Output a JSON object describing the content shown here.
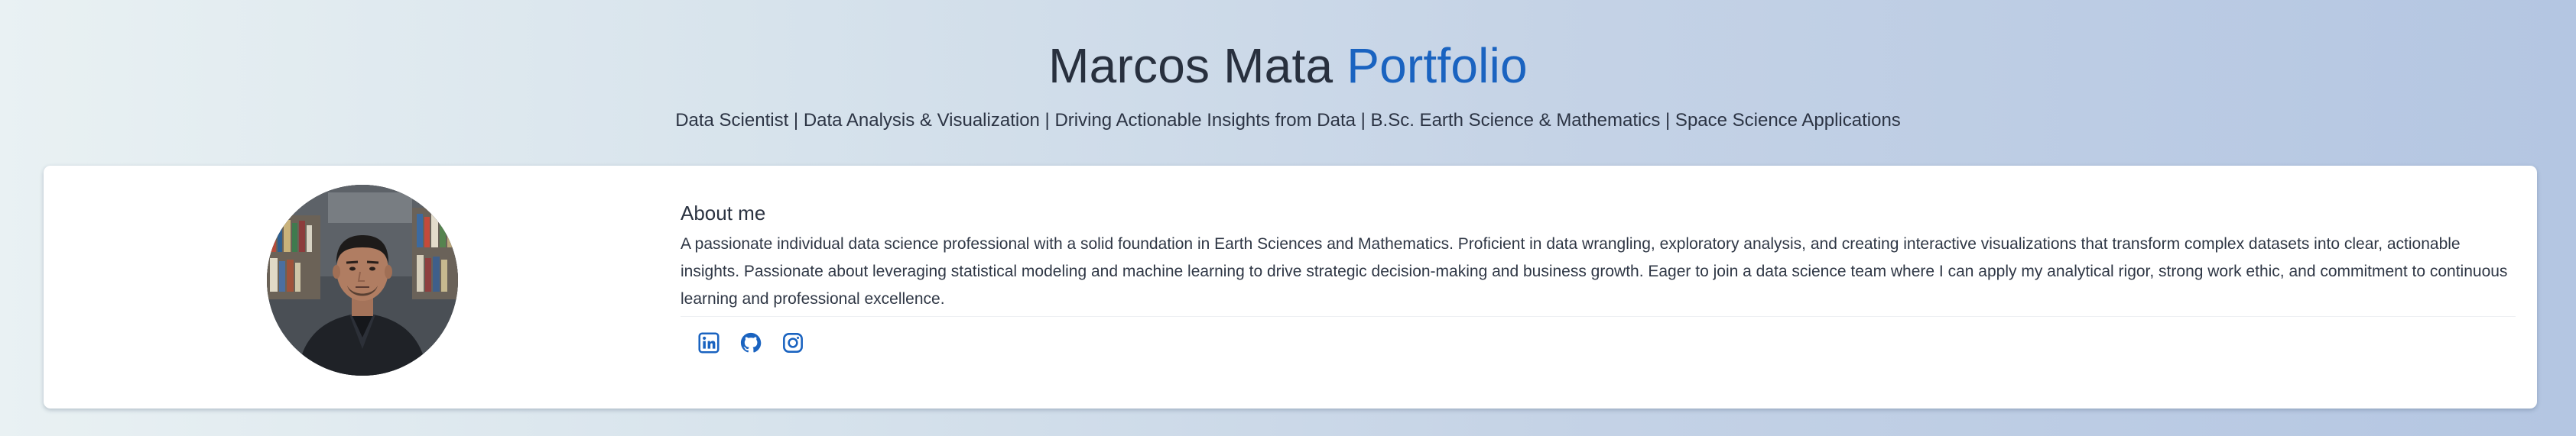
{
  "header": {
    "name": "Marcos Mata",
    "accent_word": "Portfolio",
    "tagline": "Data Scientist | Data Analysis & Visualization | Driving Actionable Insights from Data | B.Sc. Earth Science & Mathematics | Space Science Applications"
  },
  "profile": {
    "avatar_alt": "Marcos Mata"
  },
  "about": {
    "heading": "About me",
    "text": "A passionate individual data science professional with a solid foundation in Earth Sciences and Mathematics. Proficient in data wrangling, exploratory analysis, and creating interactive visualizations that transform complex datasets into clear, actionable insights. Passionate about leveraging statistical modeling and machine learning to drive strategic decision-making and business growth. Eager to join a data science team where I can apply my analytical rigor, strong work ethic, and commitment to continuous learning and professional excellence."
  },
  "socials": [
    {
      "icon": "linkedin-icon"
    },
    {
      "icon": "github-icon"
    },
    {
      "icon": "instagram-icon"
    }
  ],
  "colors": {
    "accent": "#1a63c0",
    "text": "#2b3341",
    "card_bg": "#ffffff"
  }
}
